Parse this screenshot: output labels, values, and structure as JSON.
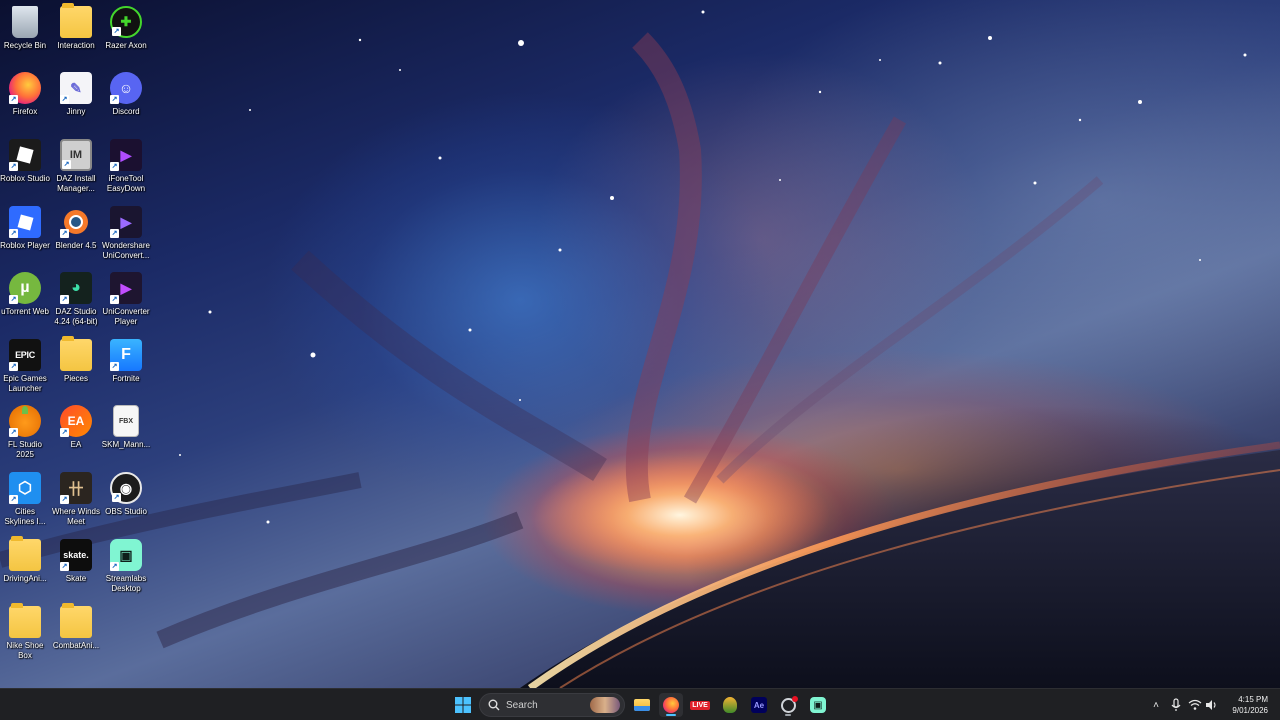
{
  "desktop": {
    "icons": [
      {
        "label": "Recycle Bin",
        "icon": "recycle-bin-icon"
      },
      {
        "label": "Interaction",
        "icon": "folder-icon"
      },
      {
        "label": "Razer Axon",
        "icon": "razer-axon-icon"
      },
      {
        "label": "Firefox",
        "icon": "firefox-icon"
      },
      {
        "label": "Jinny",
        "icon": "jinny-icon"
      },
      {
        "label": "Discord",
        "icon": "discord-icon"
      },
      {
        "label": "Roblox Studio",
        "icon": "roblox-studio-icon"
      },
      {
        "label": "DAZ Install Manager...",
        "icon": "daz-install-manager-icon"
      },
      {
        "label": "iFoneTool EasyDown",
        "icon": "ifonetool-icon"
      },
      {
        "label": "Roblox Player",
        "icon": "roblox-player-icon"
      },
      {
        "label": "Blender 4.5",
        "icon": "blender-icon"
      },
      {
        "label": "Wondershare UniConvert...",
        "icon": "wondershare-uniconverter-icon"
      },
      {
        "label": "uTorrent Web",
        "icon": "utorrent-icon"
      },
      {
        "label": "DAZ Studio 4.24 (64-bit)",
        "icon": "daz-studio-icon"
      },
      {
        "label": "UniConverter Player",
        "icon": "uniconverter-player-icon"
      },
      {
        "label": "Epic Games Launcher",
        "icon": "epic-games-icon"
      },
      {
        "label": "Pieces",
        "icon": "folder-icon"
      },
      {
        "label": "Fortnite",
        "icon": "fortnite-icon"
      },
      {
        "label": "FL Studio 2025",
        "icon": "fl-studio-icon"
      },
      {
        "label": "EA",
        "icon": "ea-icon"
      },
      {
        "label": "SKM_Mann...",
        "icon": "fbx-file-icon"
      },
      {
        "label": "Cities Skylines I...",
        "icon": "cities-skylines-icon"
      },
      {
        "label": "Where Winds Meet",
        "icon": "where-winds-meet-icon"
      },
      {
        "label": "OBS Studio",
        "icon": "obs-studio-icon"
      },
      {
        "label": "DrivingAni...",
        "icon": "folder-icon"
      },
      {
        "label": "Skate",
        "icon": "skate-icon"
      },
      {
        "label": "Streamlabs Desktop",
        "icon": "streamlabs-icon"
      },
      {
        "label": "Nike Shoe Box",
        "icon": "folder-icon"
      },
      {
        "label": "CombatAni...",
        "icon": "folder-icon"
      }
    ]
  },
  "icon_glyphs": {
    "epic": "EPIC",
    "ea": "EA",
    "fortnite": "F",
    "skate": "skate.",
    "fbx": "FBX",
    "daz_im": "IM",
    "ae": "Ae",
    "live": "LIVE"
  },
  "taskbar": {
    "search_placeholder": "Search",
    "pinned": [
      "start-icon",
      "search-icon",
      "file-explorer-icon",
      "firefox-icon",
      "live-icon",
      "razer-icon",
      "after-effects-icon",
      "steam-icon",
      "streamlabs-icon"
    ],
    "clock": {
      "time": "4:15 PM",
      "date": "9/01/2026"
    }
  },
  "colors": {
    "taskbar_bg": "#1f2023",
    "accent": "#4cc2ff"
  }
}
